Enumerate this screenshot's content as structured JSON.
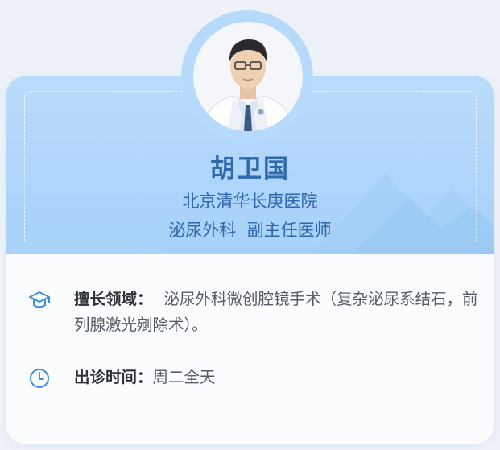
{
  "doctor": {
    "name": "胡卫国",
    "hospital": "北京清华长庚医院",
    "department_title": "泌尿外科  副主任医师"
  },
  "specialty": {
    "icon": "graduation-cap-icon",
    "label": "擅长领域：",
    "value": "泌尿外科微创腔镜手术（复杂泌尿系结石，前列腺激光剜除术）。"
  },
  "schedule": {
    "icon": "clock-icon",
    "label": "出诊时间：",
    "value": "周二全天"
  },
  "colors": {
    "accent": "#2f69ae",
    "header_bg": "#b9dbfb",
    "icon": "#3d8fe0"
  }
}
